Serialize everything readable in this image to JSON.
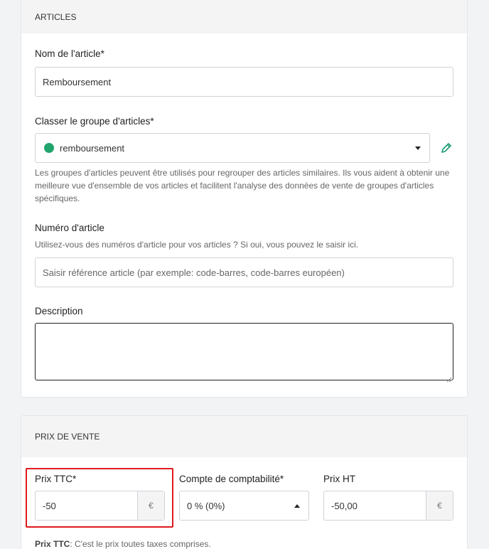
{
  "articles": {
    "header": "ARTICLES",
    "name_label": "Nom de l'article*",
    "name_value": "Remboursement",
    "group_label": "Classer le groupe d'articles*",
    "group_value": "remboursement",
    "group_color": "#1fa56d",
    "group_help": "Les groupes d'articles peuvent être utilisés pour regrouper des articles similaires. Ils vous aident à obtenir une meilleure vue d'ensemble de vos articles et facilitent l'analyse des données de vente de groupes d'articles spécifiques.",
    "number_label": "Numéro d'article",
    "number_help": "Utilisez-vous des numéros d'article pour vos articles ? Si oui, vous pouvez le saisir ici.",
    "number_placeholder": "Saisir référence article (par exemple: code-barres, code-barres européen)",
    "description_label": "Description",
    "description_value": ""
  },
  "prix": {
    "header": "PRIX DE VENTE",
    "ttc_label": "Prix TTC*",
    "ttc_value": "-50",
    "currency": "€",
    "compte_label": "Compte de comptabilité*",
    "compte_value": "0 % (0%)",
    "ht_label": "Prix HT",
    "ht_value": "-50,00",
    "note_bold": "Prix TTC",
    "note_text": ": C'est le prix toutes taxes comprises."
  },
  "colors": {
    "highlight": "#e0191e",
    "accent_green": "#1fa56d",
    "pencil": "#1a9b73"
  }
}
